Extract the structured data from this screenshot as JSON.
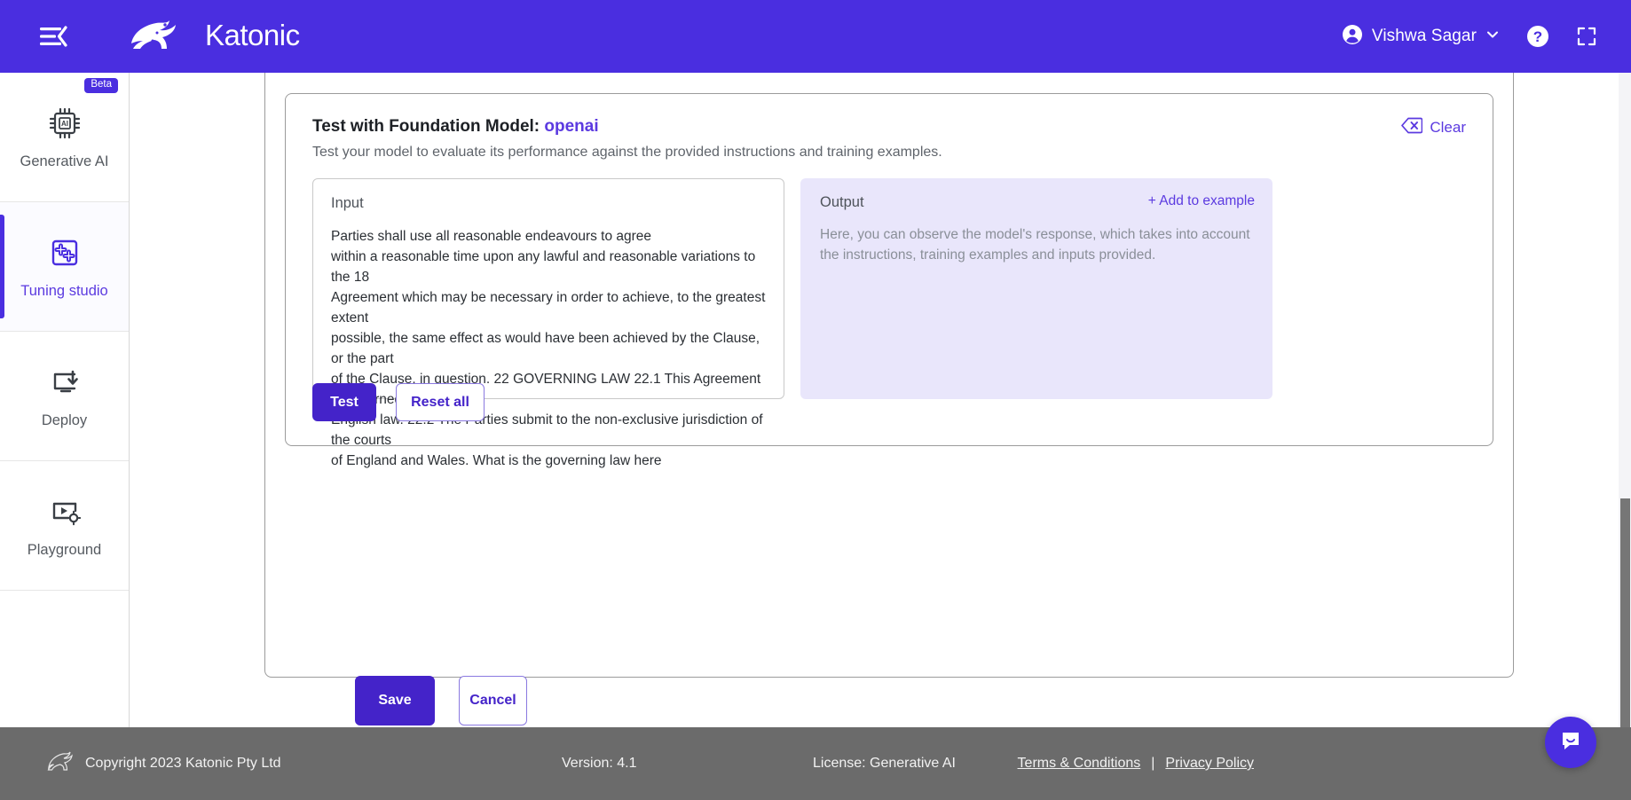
{
  "header": {
    "menu_icon": "hamburger-collapse-icon",
    "brand": "Katonic",
    "user_name": "Vishwa Sagar",
    "user_icon": "account-circle-icon",
    "chevron_icon": "chevron-down-icon",
    "help_icon": "help-circle-icon",
    "fullscreen_icon": "fullscreen-icon",
    "bg_color": "#4a2ee0"
  },
  "sidebar": {
    "items": [
      {
        "label": "Generative AI",
        "icon": "ai-chip-icon",
        "badge": "Beta",
        "active": false
      },
      {
        "label": "Tuning studio",
        "icon": "puzzle-icon",
        "badge": "",
        "active": true
      },
      {
        "label": "Deploy",
        "icon": "monitor-download-icon",
        "badge": "",
        "active": false
      },
      {
        "label": "Playground",
        "icon": "video-settings-icon",
        "badge": "",
        "active": false
      }
    ]
  },
  "test_card": {
    "title_prefix": "Test with Foundation Model:",
    "model_name": "openai",
    "subtitle": "Test your model to evaluate its performance against the provided instructions and training examples.",
    "clear_label": "Clear",
    "clear_icon": "backspace-delete-icon",
    "input": {
      "label": "Input",
      "value": "Parties shall use all reasonable endeavours to agree\nwithin a reasonable time upon any lawful and reasonable variations to the 18\nAgreement which may be necessary in order to achieve, to the greatest extent\npossible, the same effect as would have been achieved by the Clause, or the part\nof the Clause, in question. 22 GOVERNING LAW 22.1 This Agreement is governed by\nEnglish law. 22.2 The Parties submit to the non-exclusive jurisdiction of the courts\nof England and Wales. What is the governing law here"
    },
    "output": {
      "label": "Output",
      "add_to_example": "+ Add to example",
      "placeholder": "Here, you can observe the model's response, which takes into account the instructions, training examples and inputs provided.",
      "bg_color": "#e9e6fb"
    },
    "test_label": "Test",
    "reset_label": "Reset all"
  },
  "form_actions": {
    "save_label": "Save",
    "cancel_label": "Cancel",
    "primary_color": "#4423c9"
  },
  "footer": {
    "logo_icon": "kangaroo-icon",
    "copyright": "Copyright 2023 Katonic Pty Ltd",
    "version": "Version: 4.1",
    "license": "License: Generative AI",
    "terms": "Terms & Conditions",
    "separator": "|",
    "privacy": "Privacy Policy",
    "bg_color": "#6b6b6b"
  },
  "chat": {
    "icon": "chat-bubble-icon",
    "color": "#4a2ee0"
  }
}
